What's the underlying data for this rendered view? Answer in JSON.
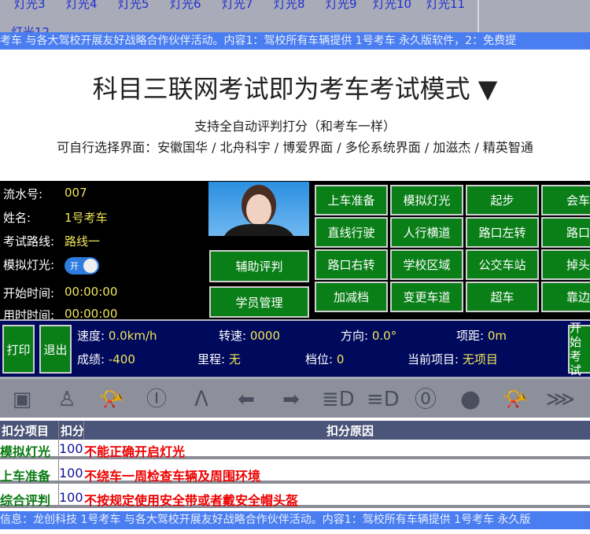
{
  "top_tabs": [
    "灯光3",
    "灯光4",
    "灯光5",
    "灯光6",
    "灯光7",
    "灯光8",
    "灯光9",
    "灯光10",
    "灯光11"
  ],
  "top_tab_partial": "灯光12",
  "ticker_top": "考车 与各大驾校开展友好战略合作伙伴活动。内容1：驾校所有车辆提供 1号考车 永久版软件，2：免费提",
  "title": "科目三联网考试即为考车考试模式 ▼",
  "subtitle1": "支持全自动评判打分（和考车一样）",
  "subtitle2": "可自行选择界面：安徽国华 / 北舟科宇 / 博爱界面 / 多伦系统界面 / 加滋杰 / 精英智通",
  "info": {
    "serial_label": "流水号:",
    "serial": "007",
    "name_label": "姓名:",
    "name": "1号考车",
    "route_label": "考试路线:",
    "route": "路线一",
    "light_label": "模拟灯光:",
    "light_toggle": "开",
    "light_on": true,
    "start_label": "开始时间:",
    "start": "00:00:00",
    "elapsed_label": "用时时间:",
    "elapsed": "00:00:00"
  },
  "side_buttons": [
    "辅助评判",
    "学员管理"
  ],
  "grid_buttons": [
    "上车准备",
    "模拟灯光",
    "起步",
    "会车",
    "直线行驶",
    "人行横道",
    "路口左转",
    "路口直行",
    "路口右转",
    "学校区域",
    "公交车站",
    "掉头",
    "加减档",
    "变更车道",
    "超车",
    "靠边停车"
  ],
  "status": {
    "print": "打印",
    "exit": "退出",
    "start_exam": "开始考试",
    "speed_label": "速度:",
    "speed": "0.0km/h",
    "rpm_label": "转速:",
    "rpm": "0000",
    "dir_label": "方向:",
    "dir": "0.0°",
    "dist_label": "项距:",
    "dist": "0m",
    "score_label": "成绩:",
    "score": "-400",
    "mileage_label": "里程:",
    "mileage": "无",
    "gear_label": "档位:",
    "gear": "0",
    "item_label": "当前项目:",
    "item": "无项目"
  },
  "icons": [
    "car-door-icon",
    "seatbelt-icon",
    "horn-icon",
    "brake-warning-icon",
    "handbrake-icon",
    "left-turn-icon",
    "right-turn-icon",
    "high-beam-icon",
    "low-beam-icon",
    "neutral-gear-icon",
    "fog-light-icon",
    "horn-icon",
    "wiper-icon"
  ],
  "table": {
    "headers": [
      "扣分项目",
      "扣分",
      "扣分原因"
    ],
    "rows": [
      {
        "item": "模拟灯光",
        "points": "100",
        "reason": "不能正确开启灯光"
      },
      {
        "item": "上车准备",
        "points": "100",
        "reason": "不绕车一周检查车辆及周围环境"
      },
      {
        "item": "综合评判",
        "points": "100",
        "reason": "不按规定使用安全带或者戴安全帽头盔"
      }
    ]
  },
  "ticker_bottom": "信息：龙创科技 1号考车 与各大驾校开展友好战略合作伙伴活动。内容1：驾校所有车辆提供 1号考车 永久版"
}
